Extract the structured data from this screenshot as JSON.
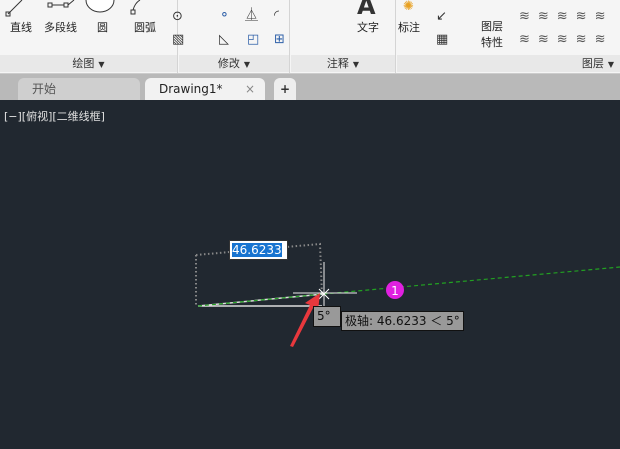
{
  "ribbon": {
    "draw": {
      "label": "绘图",
      "buttons": [
        "直线",
        "多段线",
        "圆",
        "圆弧"
      ]
    },
    "modify": {
      "label": "修改"
    },
    "annotate": {
      "label": "注释",
      "buttons": [
        "文字",
        "标注"
      ]
    },
    "layers": {
      "label": "图层",
      "buttons": [
        "图层\n特性"
      ],
      "btn_line1": "图层",
      "btn_line2": "特性"
    }
  },
  "tabs": [
    {
      "label": "开始",
      "active": false
    },
    {
      "label": "Drawing1*",
      "active": true
    }
  ],
  "new_tab": "+",
  "close": "×",
  "viewport_label": "[−][俯视][二维线框]",
  "dynamic_input": {
    "value": "46.6233"
  },
  "angle_tip": "5°",
  "polar_tip": "极轴: 46.6233 ＜ 5°",
  "marker": "1",
  "colors": {
    "canvas": "#212830",
    "selection": "#1874d0",
    "marker": "#e020e0",
    "tracking": "#22a022",
    "arrow": "#e8383d"
  }
}
